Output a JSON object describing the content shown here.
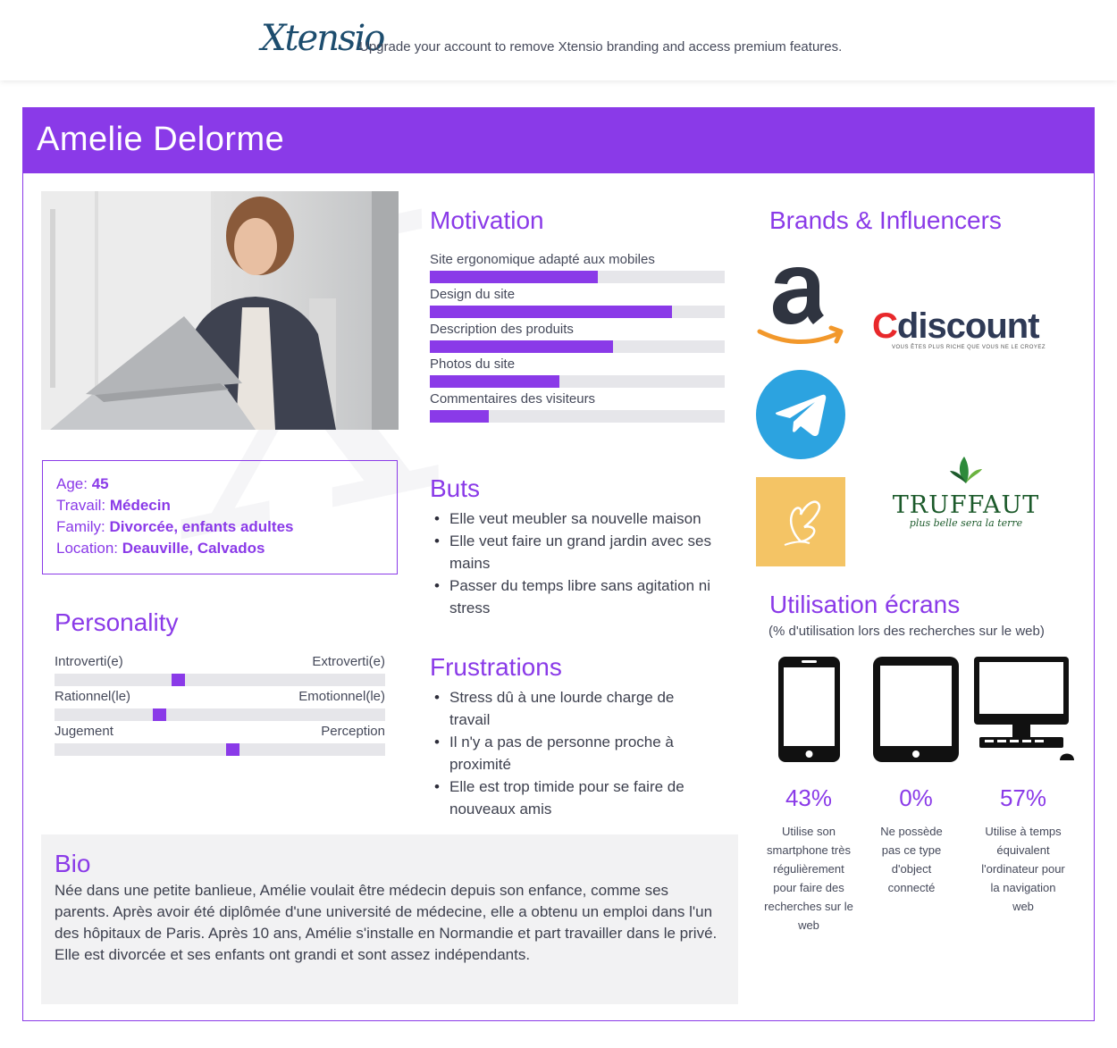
{
  "topbar": {
    "brand": "Xtensio",
    "message": "Upgrade your account to remove Xtensio branding and access premium features."
  },
  "persona": {
    "name": "Amelie Delorme",
    "info": [
      {
        "label": "Age:",
        "value": "45"
      },
      {
        "label": "Travail:",
        "value": "Médecin"
      },
      {
        "label": "Family:",
        "value": "Divorcée, enfants adultes"
      },
      {
        "label": "Location:",
        "value": "Deauville, Calvados"
      }
    ]
  },
  "personality": {
    "title": "Personality",
    "scales": [
      {
        "left": "Introverti(e)",
        "right": "Extroverti(e)",
        "position": 0.37
      },
      {
        "left": "Rationnel(le)",
        "right": "Emotionnel(le)",
        "position": 0.31
      },
      {
        "left": "Jugement",
        "right": "Perception",
        "position": 0.54
      }
    ]
  },
  "motivation": {
    "title": "Motivation",
    "items": [
      {
        "label": "Site ergonomique adapté aux mobiles",
        "level": 0.57
      },
      {
        "label": "Design du site",
        "level": 0.82
      },
      {
        "label": "Description des produits",
        "level": 0.62
      },
      {
        "label": "Photos du site",
        "level": 0.44
      },
      {
        "label": "Commentaires des visiteurs",
        "level": 0.2
      }
    ]
  },
  "goals": {
    "title": "Buts",
    "items": [
      "Elle veut meubler sa nouvelle maison",
      "Elle veut faire un grand jardin avec ses mains",
      "Passer du temps libre sans agitation ni stress"
    ]
  },
  "frustrations": {
    "title": "Frustrations",
    "items": [
      "Stress dû à une lourde charge de travail",
      "Il n'y a pas de personne proche à proximité",
      "Elle est trop timide pour se faire de nouveaux amis"
    ]
  },
  "bio": {
    "title": "Bio",
    "text": "Née dans une petite banlieue, Amélie voulait être médecin depuis son enfance, comme ses parents. Après avoir été diplômée d'une université de médecine, elle a obtenu un emploi dans l'un des hôpitaux de Paris. Après 10 ans, Amélie s'installe en Normandie et part travailler dans le privé. Elle est divorcée et ses enfants ont grandi et sont assez indépendants."
  },
  "brands": {
    "title": "Brands & Influencers",
    "logos": [
      {
        "name": "amazon",
        "icon": "amazon-logo"
      },
      {
        "name": "cdiscount",
        "text_c": "C",
        "text_rest": "discount",
        "tagline": "VOUS ÊTES PLUS RICHE QUE VOUS NE LE CROYEZ"
      },
      {
        "name": "telegram",
        "icon": "telegram-logo",
        "color": "#2ca3e0"
      },
      {
        "name": "butterfly-app",
        "icon": "butterfly-logo",
        "color": "#f4c465"
      },
      {
        "name": "truffaut",
        "text": "TRUFFAUT",
        "tagline": "plus belle sera la terre"
      }
    ]
  },
  "screens": {
    "title": "Utilisation écrans",
    "subtitle": "(% d'utilisation lors des recherches sur le web)",
    "devices": [
      {
        "icon": "smartphone-icon",
        "percent": "43%",
        "desc": "Utilise son smartphone très régulièrement pour faire des recherches sur le web"
      },
      {
        "icon": "tablet-icon",
        "percent": "0%",
        "desc": "Ne possède pas ce type d'object connecté"
      },
      {
        "icon": "desktop-computer-icon",
        "percent": "57%",
        "desc": "Utilise à temps équivalent l'ordinateur pour la navigation web"
      }
    ]
  },
  "colors": {
    "accent": "#8a3ae8",
    "track": "#e6e6ea",
    "bio_bg": "#f2f2f3"
  }
}
